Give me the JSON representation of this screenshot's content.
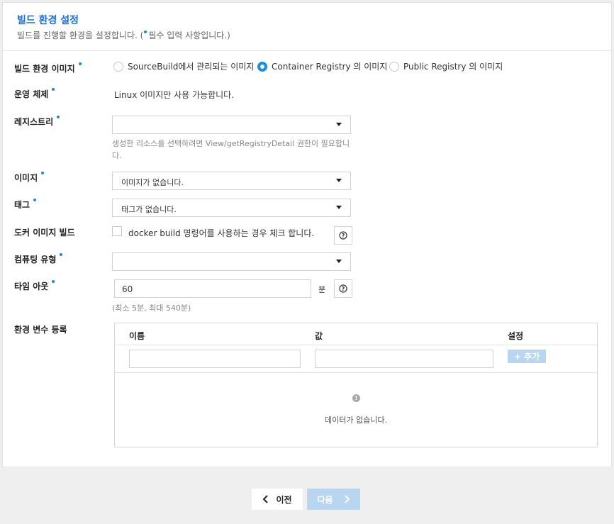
{
  "header": {
    "title": "빌드 환경 설정",
    "subtitle_before": "빌드를 진행할 환경을 설정합니다. (",
    "subtitle_after": "필수 입력 사항입니다.)"
  },
  "build_image": {
    "label": "빌드 환경 이미지",
    "options": [
      "SourceBuild에서 관리되는 이미지",
      "Container Registry 의 이미지",
      "Public Registry 의 이미지"
    ],
    "selected": "Container Registry 의 이미지"
  },
  "os": {
    "label": "운영 체제",
    "value": "Linux 이미지만 사용 가능합니다."
  },
  "registry": {
    "label": "레지스트리",
    "value": "",
    "hint_line1": "생성한 리소스를 선택하려면 View/getRegistryDetail 권한이 필요합니",
    "hint_line2": "다."
  },
  "image": {
    "label": "이미지",
    "value": "이미지가 없습니다."
  },
  "tag": {
    "label": "태그",
    "value": "태그가 없습니다."
  },
  "docker_build": {
    "label": "도커 이미지 빌드",
    "checkbox_text": "docker build 명령어를 사용하는 경우 체크 합니다.",
    "checked": false
  },
  "compute_type": {
    "label": "컴퓨팅 유형",
    "value": ""
  },
  "timeout": {
    "label": "타임 아웃",
    "value": "60",
    "unit": "분",
    "hint": "(최소 5분, 최대 540분)"
  },
  "env_vars": {
    "label": "환경 변수 등록",
    "col_name": "이름",
    "col_value": "값",
    "col_settings": "설정",
    "add_label": "+ 추가",
    "empty_icon": "!",
    "empty_text": "데이터가 없습니다."
  },
  "nav": {
    "prev_label": "이전",
    "next_label": "다음"
  },
  "colors": {
    "accent": "#1a8be0",
    "title": "#1a6fd1",
    "disabled_button": "#b8d6f0"
  }
}
